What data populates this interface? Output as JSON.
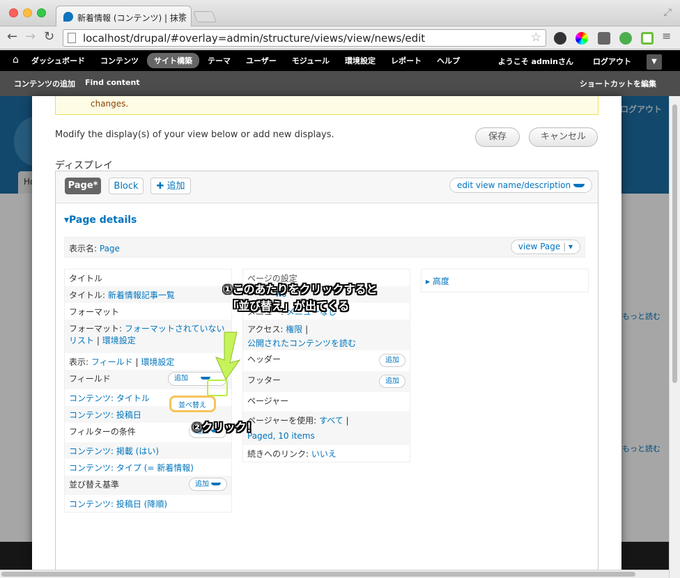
{
  "browser": {
    "tab_title": "新着情報 (コンテンツ) | 抹茶",
    "url": "localhost/drupal/#overlay=admin/structure/views/view/news/edit"
  },
  "admin_menu": {
    "items": [
      "ダッシュボード",
      "コンテンツ",
      "サイト構築",
      "テーマ",
      "ユーザー",
      "モジュール",
      "環境設定",
      "レポート",
      "ヘルプ"
    ],
    "active": "サイト構築",
    "welcome": "ようこそ adminさん",
    "logout": "ログアウト"
  },
  "shortcuts": {
    "add_content": "コンテンツの追加",
    "find_content": "Find content",
    "edit_shortcuts": "ショートカットを編集"
  },
  "background": {
    "logout": "ログアウト",
    "tab_label": "Ho",
    "more1": "もっと読む",
    "more2": "もっと読む"
  },
  "warning": {
    "text": "changes."
  },
  "intro": "Modify the display(s) of your view below or add new displays.",
  "buttons": {
    "save": "保存",
    "cancel": "キャンセル"
  },
  "display_section": "ディスプレイ",
  "display_tabs": {
    "page": "Page*",
    "block": "Block",
    "add": "✚ 追加"
  },
  "edit_view_name": "edit view name/description",
  "details": {
    "title": "▾Page details",
    "display_name_label": "表示名:",
    "display_name_value": "Page",
    "view_page": "view Page"
  },
  "col1": {
    "title_head": "タイトル",
    "title_label": "タイトル:",
    "title_value": "新着情報記事一覧",
    "format_head": "フォーマット",
    "format_label": "フォーマット:",
    "format_value": "フォーマットされていないリスト",
    "format_settings": "環境設定",
    "show_label": "表示:",
    "show_value": "フィールド",
    "show_settings": "環境設定",
    "fields_head": "フィールド",
    "fields_add": "追加",
    "sort_button": "並べ替え",
    "field1": "コンテンツ: タイトル",
    "field2": "コンテンツ: 投稿日",
    "filter_head": "フィルターの条件",
    "filter_add": "追加",
    "filter1": "コンテンツ: 掲載 (はい)",
    "filter2": "コンテンツ: タイプ (= 新着情報)",
    "sort_head": "並び替え基準",
    "sort_add": "追加",
    "sort1": "コンテンツ: 投稿日 (降順)"
  },
  "col2": {
    "page_settings_head": "ページの設定",
    "path_partial": "ws",
    "menu_label": "メニュー:",
    "menu_value": "メニューなし",
    "access_label": "アクセス:",
    "access_value": "権限",
    "access_perm": "公開されたコンテンツを読む",
    "header": "ヘッダー",
    "header_add": "追加",
    "footer": "フッター",
    "footer_add": "追加",
    "pager_head": "ページャー",
    "pager_label": "ページャーを使用:",
    "pager_value": "すべて",
    "pager_items": "Paged, 10 items",
    "more_label": "続きへのリンク:",
    "more_value": "いいえ"
  },
  "col3": {
    "advanced": "▸ 高度"
  },
  "annotations": {
    "step1_line1": "①このあたりをクリックすると",
    "step1_line2": "「並び替え」が出てくる",
    "step2": "②クリック！"
  },
  "colors": {
    "link": "#0074bd",
    "highlight_green": "#b6f03a",
    "highlight_orange": "#f5c45a"
  }
}
